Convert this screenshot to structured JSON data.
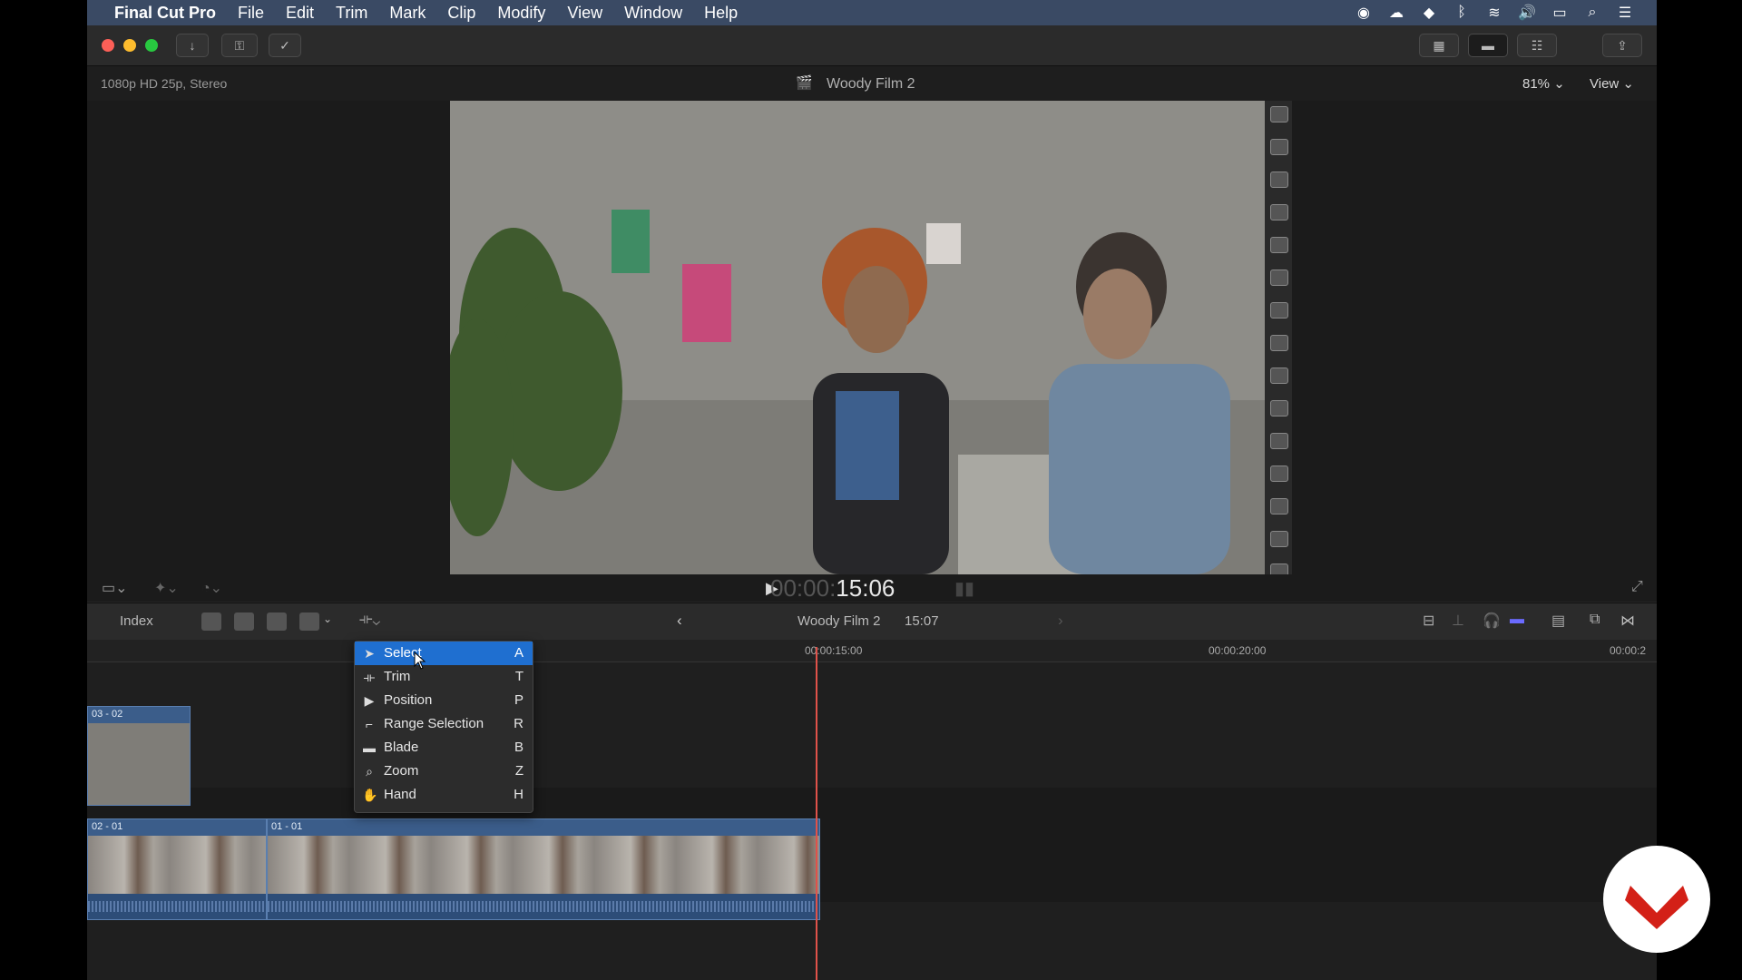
{
  "menubar": {
    "app_name": "Final Cut Pro",
    "items": [
      "File",
      "Edit",
      "Trim",
      "Mark",
      "Clip",
      "Modify",
      "View",
      "Window",
      "Help"
    ]
  },
  "viewer": {
    "format": "1080p HD 25p, Stereo",
    "project_title": "Woody Film 2",
    "zoom": "81%",
    "view_label": "View",
    "timecode_dim": "00:00:",
    "timecode_main": "15:06"
  },
  "timeline": {
    "index_label": "Index",
    "project_name": "Woody Film 2",
    "duration": "15:07",
    "ruler": [
      "00:00:15:00",
      "00:00:20:00",
      "00:00:2"
    ],
    "clips": {
      "connected": "03 - 02",
      "clip_a": "02 - 01",
      "clip_b": "01 - 01"
    }
  },
  "tools_menu": [
    {
      "label": "Select",
      "key": "A",
      "icon": "arrow-icon"
    },
    {
      "label": "Trim",
      "key": "T",
      "icon": "trim-icon"
    },
    {
      "label": "Position",
      "key": "P",
      "icon": "position-icon"
    },
    {
      "label": "Range Selection",
      "key": "R",
      "icon": "range-selection-icon"
    },
    {
      "label": "Blade",
      "key": "B",
      "icon": "blade-icon"
    },
    {
      "label": "Zoom",
      "key": "Z",
      "icon": "zoom-icon"
    },
    {
      "label": "Hand",
      "key": "H",
      "icon": "hand-icon"
    }
  ],
  "colors": {
    "accent": "#1f6fd0",
    "playhead": "#e0524a",
    "clip": "#3b5d8a"
  }
}
